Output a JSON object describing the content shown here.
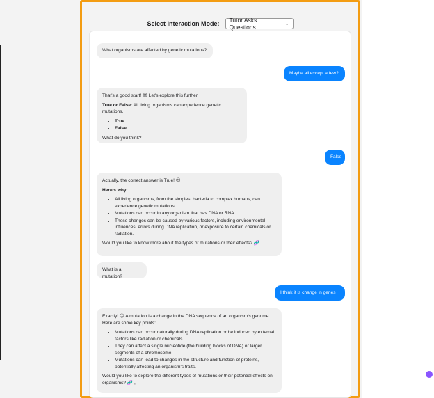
{
  "mode_bar": {
    "label": "Select Interaction Mode:",
    "selected": "Tutor Asks Questions"
  },
  "chat": {
    "messages": [
      {
        "role": "bot",
        "text": "What organisms are affected by genetic mutations?"
      },
      {
        "role": "user",
        "text": "Maybe all except a few?"
      },
      {
        "role": "bot",
        "line1": "That's a good start! 😊 Let's explore this further.",
        "q_label": "True or False:",
        "q_text": " All living organisms can experience genetic mutations.",
        "options": [
          "True",
          "False"
        ],
        "closing": "What do you think?"
      },
      {
        "role": "user",
        "text": "False"
      },
      {
        "role": "bot",
        "line1": "Actually, the correct answer is True! 😊",
        "heading": "Here's why:",
        "bullets": [
          "All living organisms, from the simplest bacteria to complex humans, can experience genetic mutations.",
          "Mutations can occur in any organism that has DNA or RNA.",
          "These changes can be caused by various factors, including environmental influences, errors during DNA replication, or exposure to certain chemicals or radiation."
        ],
        "closing": "Would you like to know more about the types of mutations or their effects? 🧬"
      },
      {
        "role": "bot",
        "text": "What is a mutation?"
      },
      {
        "role": "user",
        "text": "I think it is change in genes"
      },
      {
        "role": "bot",
        "line1": "Exactly! 😊 A mutation is a change in the DNA sequence of an organism's genome. Here are some key points:",
        "bullets": [
          "Mutations can occur naturally during DNA replication or be induced by external factors like radiation or chemicals.",
          "They can affect a single nucleotide (the building blocks of DNA) or larger segments of a chromosome.",
          "Mutations can lead to changes in the structure and function of proteins, potentially affecting an organism's traits."
        ],
        "closing": "Would you like to explore the different types of mutations or their potential effects on organisms? 🧬 ,"
      }
    ]
  },
  "colors": {
    "accent": "#f39c12",
    "user_bubble": "#0a84ff",
    "bot_bubble": "#efefef"
  }
}
